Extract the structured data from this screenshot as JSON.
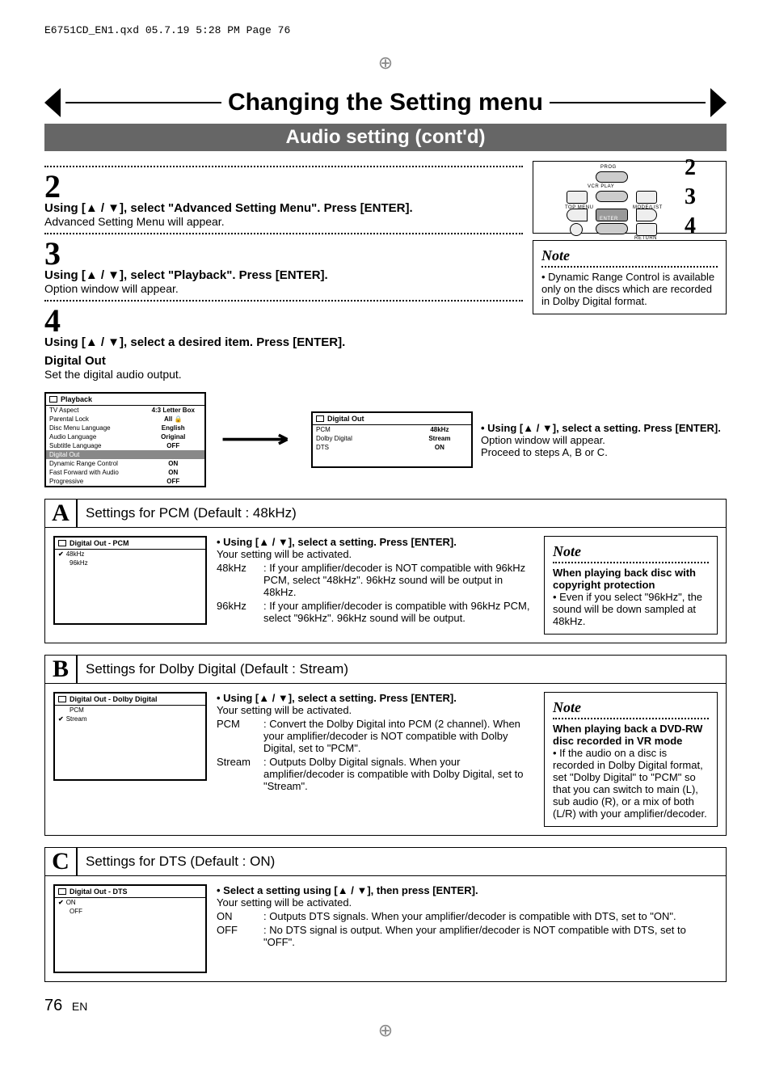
{
  "file_header": "E6751CD_EN1.qxd  05.7.19  5:28 PM  Page 76",
  "title": "Changing the Setting menu",
  "subtitle": "Audio setting (cont'd)",
  "steps": {
    "s2": {
      "num": "2",
      "instr": "Using [▲ / ▼], select \"Advanced Setting Menu\". Press [ENTER].",
      "after": "Advanced Setting Menu will appear."
    },
    "s3": {
      "num": "3",
      "instr": "Using [▲ / ▼], select \"Playback\". Press [ENTER].",
      "after": "Option window will appear."
    },
    "s4": {
      "num": "4",
      "instr": "Using [▲ / ▼], select a desired item. Press [ENTER].",
      "sub": "Digital Out",
      "subnote": "Set the digital audio output."
    }
  },
  "remote": {
    "labels": {
      "prog": "PROG",
      "vcrplay": "VCR PLAY",
      "topmenu": "TOP MENU",
      "modelist": "MODE/LIST",
      "enter": "ENTER",
      "return": "RETURN"
    },
    "callouts": [
      "2",
      "3",
      "4"
    ]
  },
  "note_drc": {
    "title": "Note",
    "body": "• Dynamic Range Control is available only on the discs which are recorded in Dolby Digital format."
  },
  "osd_playback": {
    "title": "Playback",
    "rows": [
      {
        "k": "TV Aspect",
        "v": "4:3 Letter Box"
      },
      {
        "k": "Parental Lock",
        "v": "All  🔒"
      },
      {
        "k": "Disc Menu Language",
        "v": "English"
      },
      {
        "k": "Audio Language",
        "v": "Original"
      },
      {
        "k": "Subtitle Language",
        "v": "OFF"
      },
      {
        "k": "Digital Out",
        "v": "",
        "hl": true
      },
      {
        "k": "Dynamic Range Control",
        "v": "ON"
      },
      {
        "k": "Fast Forward with Audio",
        "v": "ON"
      },
      {
        "k": "Progressive",
        "v": "OFF"
      }
    ]
  },
  "osd_digitalout": {
    "title": "Digital Out",
    "rows": [
      {
        "k": "PCM",
        "v": "48kHz"
      },
      {
        "k": "Dolby Digital",
        "v": "Stream"
      },
      {
        "k": "DTS",
        "v": "ON"
      }
    ]
  },
  "digitalout_text": {
    "lead": "• Using [▲ / ▼], select a setting. Press [ENTER].",
    "after1": "Option window will appear.",
    "after2": "Proceed to steps A, B or C."
  },
  "sectionA": {
    "letter": "A",
    "title": "Settings for PCM (Default : 48kHz)",
    "osd": {
      "title": "Digital Out - PCM",
      "rows": [
        {
          "k": "48kHz",
          "checked": true
        },
        {
          "k": "96kHz"
        }
      ]
    },
    "lead": "• Using [▲ / ▼], select a setting. Press [ENTER].",
    "activated": "Your setting will be activated.",
    "items": [
      {
        "k": "48kHz",
        "v": ": If your amplifier/decoder is NOT compatible with 96kHz PCM, select \"48kHz\". 96kHz sound will be output in 48kHz."
      },
      {
        "k": "96kHz",
        "v": ": If your amplifier/decoder is compatible with 96kHz PCM, select \"96kHz\". 96kHz sound will be output."
      }
    ],
    "note": {
      "title": "Note",
      "heading": "When playing back disc with copyright protection",
      "body": "• Even if you select \"96kHz\", the sound will be down sampled at 48kHz."
    }
  },
  "sectionB": {
    "letter": "B",
    "title": "Settings for Dolby Digital (Default : Stream)",
    "osd": {
      "title": "Digital Out - Dolby Digital",
      "rows": [
        {
          "k": "PCM"
        },
        {
          "k": "Stream",
          "checked": true
        }
      ]
    },
    "lead": "• Using [▲ / ▼], select a setting. Press [ENTER].",
    "activated": "Your setting will be activated.",
    "items": [
      {
        "k": "PCM",
        "v": ": Convert the Dolby Digital into PCM (2 channel). When your amplifier/decoder is NOT compatible with Dolby Digital, set to \"PCM\"."
      },
      {
        "k": "Stream",
        "v": ": Outputs Dolby Digital signals. When your amplifier/decoder is compatible with Dolby Digital, set to \"Stream\"."
      }
    ],
    "note": {
      "title": "Note",
      "heading": "When playing back a DVD-RW disc recorded in VR mode",
      "body": "• If the audio on a disc is recorded in Dolby Digital format, set \"Dolby Digital\" to \"PCM\" so that you can switch to main (L), sub audio (R), or a mix of both (L/R) with your amplifier/decoder."
    }
  },
  "sectionC": {
    "letter": "C",
    "title": "Settings for DTS (Default : ON)",
    "osd": {
      "title": "Digital Out - DTS",
      "rows": [
        {
          "k": "ON",
          "checked": true
        },
        {
          "k": "OFF"
        }
      ]
    },
    "lead": "• Select a setting using [▲ / ▼], then press [ENTER].",
    "activated": "Your setting will be activated.",
    "items": [
      {
        "k": "ON",
        "v": ": Outputs DTS signals. When your amplifier/decoder is compatible with DTS, set to \"ON\"."
      },
      {
        "k": "OFF",
        "v": ": No DTS signal is output. When your amplifier/decoder is NOT compatible with DTS, set to \"OFF\"."
      }
    ]
  },
  "page": {
    "num": "76",
    "lang": "EN"
  }
}
